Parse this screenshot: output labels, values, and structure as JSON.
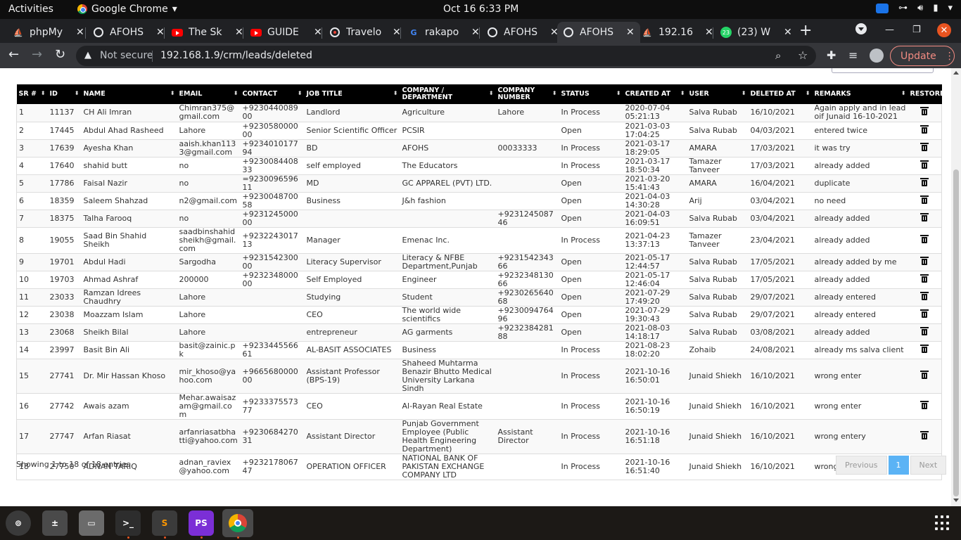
{
  "topbar": {
    "activities": "Activities",
    "app_name": "Google Chrome",
    "clock": "Oct 16  6:33 PM"
  },
  "tabs": [
    {
      "title": "phpMy",
      "icon": "phpmyadmin-icon"
    },
    {
      "title": "AFOHS",
      "icon": "globe-icon"
    },
    {
      "title": "The Sk",
      "icon": "youtube-icon"
    },
    {
      "title": "GUIDE",
      "icon": "youtube-icon"
    },
    {
      "title": "Travelo",
      "icon": "record-icon"
    },
    {
      "title": "rakapo",
      "icon": "google-icon"
    },
    {
      "title": "AFOHS",
      "icon": "globe-icon"
    },
    {
      "title": "AFOHS",
      "icon": "globe-icon",
      "active": true
    },
    {
      "title": "192.16",
      "icon": "phpmyadmin-icon"
    },
    {
      "title": "(23) W",
      "icon": "whatsapp-icon",
      "badge": "23"
    }
  ],
  "toolbar": {
    "not_secure": "Not secure",
    "url": "192.168.1.9/crm/leads/deleted",
    "update_label": "Update"
  },
  "table": {
    "columns": [
      "SR #",
      "ID",
      "NAME",
      "EMAIL",
      "CONTACT",
      "JOB TITLE",
      "COMPANY / DEPARTMENT",
      "COMPANY NUMBER",
      "STATUS",
      "CREATED AT",
      "USER",
      "DELETED AT",
      "REMARKS",
      "RESTORE"
    ],
    "rows": [
      {
        "sr": "1",
        "id": "11137",
        "name": "CH Ali Imran",
        "email": "Chimran375@gmail.com",
        "contact": "+923044008900",
        "job": "Landlord",
        "company": "Agriculture",
        "company_number": "Lahore",
        "status": "In Process",
        "created": "2020-07-04 05:21:13",
        "user": "Salva Rubab",
        "deleted": "16/10/2021",
        "remarks": "Again apply and in lead oif Junaid 16-10-2021"
      },
      {
        "sr": "2",
        "id": "17445",
        "name": "Abdul Ahad Rasheed",
        "email": "Lahore",
        "contact": "+923058000000",
        "job": "Senior Scientific Officer",
        "company": "PCSIR",
        "company_number": "",
        "status": "Open",
        "created": "2021-03-03 17:04:25",
        "user": "Salva Rubab",
        "deleted": "04/03/2021",
        "remarks": "entered twice"
      },
      {
        "sr": "3",
        "id": "17639",
        "name": "Ayesha Khan",
        "email": "aaish.khan1133@gmail.com",
        "contact": "+923401017794",
        "job": "BD",
        "company": "AFOHS",
        "company_number": "00033333",
        "status": "In Process",
        "created": "2021-03-17 18:29:05",
        "user": "AMARA",
        "deleted": "17/03/2021",
        "remarks": "it was try"
      },
      {
        "sr": "4",
        "id": "17640",
        "name": "shahid butt",
        "email": "no",
        "contact": "+923008440833",
        "job": "self employed",
        "company": "The Educators",
        "company_number": "",
        "status": "In Process",
        "created": "2021-03-17 18:50:34",
        "user": "Tamazer Tanveer",
        "deleted": "17/03/2021",
        "remarks": "already added"
      },
      {
        "sr": "5",
        "id": "17786",
        "name": "Faisal Nazir",
        "email": "no",
        "contact": "=923009659611",
        "job": "MD",
        "company": "GC APPAREL (PVT) LTD.",
        "company_number": "",
        "status": "Open",
        "created": "2021-03-20 15:41:43",
        "user": "AMARA",
        "deleted": "16/04/2021",
        "remarks": "duplicate"
      },
      {
        "sr": "6",
        "id": "18359",
        "name": "Saleem Shahzad",
        "email": "n2@gmail.com",
        "contact": "+923004870058",
        "job": "Business",
        "company": "J&h fashion",
        "company_number": "",
        "status": "Open",
        "created": "2021-04-03 14:30:28",
        "user": "Arij",
        "deleted": "03/04/2021",
        "remarks": "no need"
      },
      {
        "sr": "7",
        "id": "18375",
        "name": "Talha Farooq",
        "email": "no",
        "contact": "+923124500000",
        "job": "",
        "company": "",
        "company_number": "+923124508746",
        "status": "Open",
        "created": "2021-04-03 16:09:51",
        "user": "Salva Rubab",
        "deleted": "03/04/2021",
        "remarks": "already added"
      },
      {
        "sr": "8",
        "id": "19055",
        "name": "Saad Bin Shahid Sheikh",
        "email": "saadbinshahidsheikh@gmail.com",
        "contact": "+923224301713",
        "job": "Manager",
        "company": "Emenac Inc.",
        "company_number": "",
        "status": "In Process",
        "created": "2021-04-23 13:37:13",
        "user": "Tamazer Tanveer",
        "deleted": "23/04/2021",
        "remarks": "already added"
      },
      {
        "sr": "9",
        "id": "19701",
        "name": "Abdul Hadi",
        "email": "Sargodha",
        "contact": "+923154230000",
        "job": "Literacy Supervisor",
        "company": "Literacy & NFBE Department,Punjab",
        "company_number": "+923154234366",
        "status": "Open",
        "created": "2021-05-17 12:44:57",
        "user": "Salva Rubab",
        "deleted": "17/05/2021",
        "remarks": "already added by me"
      },
      {
        "sr": "10",
        "id": "19703",
        "name": "Ahmad Ashraf",
        "email": "200000",
        "contact": "+923234800000",
        "job": "Self Employed",
        "company": "Engineer",
        "company_number": "+923234813066",
        "status": "Open",
        "created": "2021-05-17 12:46:04",
        "user": "Salva Rubab",
        "deleted": "17/05/2021",
        "remarks": "already added"
      },
      {
        "sr": "11",
        "id": "23033",
        "name": "Ramzan Idrees Chaudhry",
        "email": "Lahore",
        "contact": "",
        "job": "Studying",
        "company": "Student",
        "company_number": "+923026564068",
        "status": "Open",
        "created": "2021-07-29 17:49:20",
        "user": "Salva Rubab",
        "deleted": "29/07/2021",
        "remarks": "already entered"
      },
      {
        "sr": "12",
        "id": "23038",
        "name": "Moazzam Islam",
        "email": "Lahore",
        "contact": "",
        "job": "CEO",
        "company": "The world wide scientifics",
        "company_number": "+923009476496",
        "status": "Open",
        "created": "2021-07-29 19:30:43",
        "user": "Salva Rubab",
        "deleted": "29/07/2021",
        "remarks": "already entered"
      },
      {
        "sr": "13",
        "id": "23068",
        "name": "Sheikh Bilal",
        "email": "Lahore",
        "contact": "",
        "job": "entrepreneur",
        "company": "AG garments",
        "company_number": "+923238428188",
        "status": "Open",
        "created": "2021-08-03 14:18:17",
        "user": "Salva Rubab",
        "deleted": "03/08/2021",
        "remarks": "already added"
      },
      {
        "sr": "14",
        "id": "23997",
        "name": "Basit Bin Ali",
        "email": "basit@zainic.pk",
        "contact": "+923344556661",
        "job": "AL-BASIT ASSOCIATES",
        "company": "Business",
        "company_number": "",
        "status": "In Process",
        "created": "2021-08-23 18:02:20",
        "user": "Zohaib",
        "deleted": "24/08/2021",
        "remarks": "already ms salva client"
      },
      {
        "sr": "15",
        "id": "27741",
        "name": "Dr. Mir Hassan Khoso",
        "email": "mir_khoso@yahoo.com",
        "contact": "+966568000000",
        "job": "Assistant Professor (BPS-19)",
        "company": "Shaheed Muhtarma Benazir Bhutto Medical University Larkana Sindh",
        "company_number": "",
        "status": "In Process",
        "created": "2021-10-16 16:50:01",
        "user": "Junaid Shiekh",
        "deleted": "16/10/2021",
        "remarks": "wrong enter"
      },
      {
        "sr": "16",
        "id": "27742",
        "name": "Awais azam",
        "email": "Mehar.awaisazam@gmail.com",
        "contact": "+923337557377",
        "job": "CEO",
        "company": "Al-Rayan Real Estate",
        "company_number": "",
        "status": "In Process",
        "created": "2021-10-16 16:50:19",
        "user": "Junaid Shiekh",
        "deleted": "16/10/2021",
        "remarks": "wrong enter"
      },
      {
        "sr": "17",
        "id": "27747",
        "name": "Arfan Riasat",
        "email": "arfanriasatbhatti@yahoo.com",
        "contact": "+923068427031",
        "job": "Assistant Director",
        "company": "Punjab Government Employee (Public Health Engineering Department)",
        "company_number": "Assistant Director",
        "status": "In Process",
        "created": "2021-10-16 16:51:18",
        "user": "Junaid Shiekh",
        "deleted": "16/10/2021",
        "remarks": "wrong entery"
      },
      {
        "sr": "18",
        "id": "27750",
        "name": "ADNAN TARIQ",
        "email": "adnan_raviex@yahoo.com",
        "contact": "+923217806747",
        "job": "OPERATION OFFICER",
        "company": "NATIONAL BANK OF PAKISTAN EXCHANGE COMPANY LTD",
        "company_number": "",
        "status": "In Process",
        "created": "2021-10-16 16:51:40",
        "user": "Junaid Shiekh",
        "deleted": "16/10/2021",
        "remarks": "wrong entry"
      }
    ]
  },
  "footer": {
    "showing": "Showing 1 to 18 of 18 entries",
    "previous": "Previous",
    "current_page": "1",
    "next": "Next"
  },
  "dock": {
    "apps": [
      "files-icon",
      "calculator-icon",
      "folder-icon",
      "terminal-icon",
      "sublime-icon",
      "phpstorm-icon",
      "chrome-icon"
    ]
  },
  "colors": {
    "table_header": "#000000",
    "active_page": "#5bb3f5",
    "update_button": "#f28b82"
  }
}
